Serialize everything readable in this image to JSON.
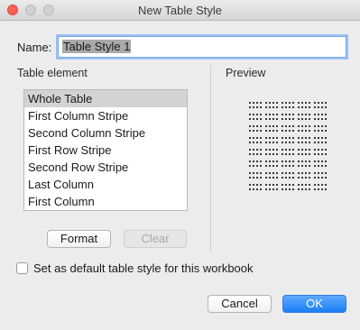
{
  "window": {
    "title": "New Table Style"
  },
  "name_field": {
    "label": "Name:",
    "value": "Table Style 1"
  },
  "table_element": {
    "label": "Table element",
    "items": [
      {
        "label": "Whole Table",
        "selected": true
      },
      {
        "label": "First Column Stripe",
        "selected": false
      },
      {
        "label": "Second Column Stripe",
        "selected": false
      },
      {
        "label": "First Row Stripe",
        "selected": false
      },
      {
        "label": "Second Row Stripe",
        "selected": false
      },
      {
        "label": "Last Column",
        "selected": false
      },
      {
        "label": "First Column",
        "selected": false
      }
    ]
  },
  "preview": {
    "label": "Preview"
  },
  "buttons": {
    "format": "Format",
    "clear": "Clear",
    "cancel": "Cancel",
    "ok": "OK"
  },
  "default_checkbox": {
    "label": "Set as default table style for this workbook",
    "checked": false
  },
  "colors": {
    "accent": "#1a7ff5",
    "close": "#fc5f57"
  }
}
